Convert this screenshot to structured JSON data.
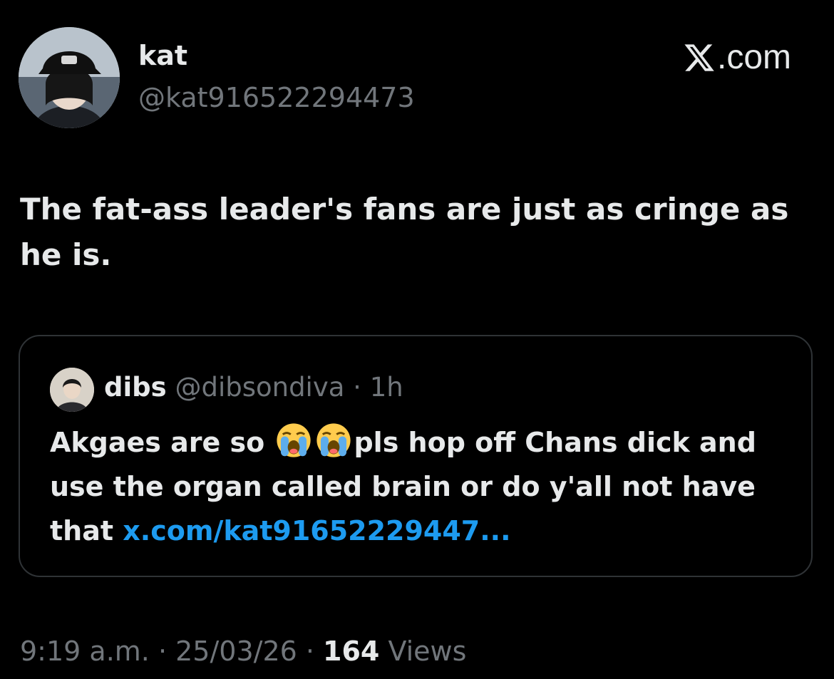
{
  "author": {
    "display_name": "kat",
    "handle": "@kat916522294473"
  },
  "brand": {
    "icon": "x-logo-icon",
    "text": ".com"
  },
  "tweet": {
    "text": "The fat-ass leader's fans are just as cringe as he is."
  },
  "quoted_tweet": {
    "display_name": "dibs",
    "handle": "@dibsondiva",
    "separator": " · ",
    "time": "1h",
    "text_before": "Akgaes are so ",
    "emoji": "loudly-crying-face-icon",
    "text_after": "pls hop off Chans dick and use the organ called brain or do y'all not have that ",
    "link": "x.com/kat91652229447..."
  },
  "meta": {
    "time": "9:19 a.m.",
    "separator": " · ",
    "date": "25/03/26",
    "views_count": "164",
    "views_label": " Views"
  },
  "colors": {
    "background": "#000000",
    "primary_text": "#e7e9ea",
    "secondary_text": "#71767b",
    "link": "#1d9bf0",
    "border": "#2f3336"
  }
}
